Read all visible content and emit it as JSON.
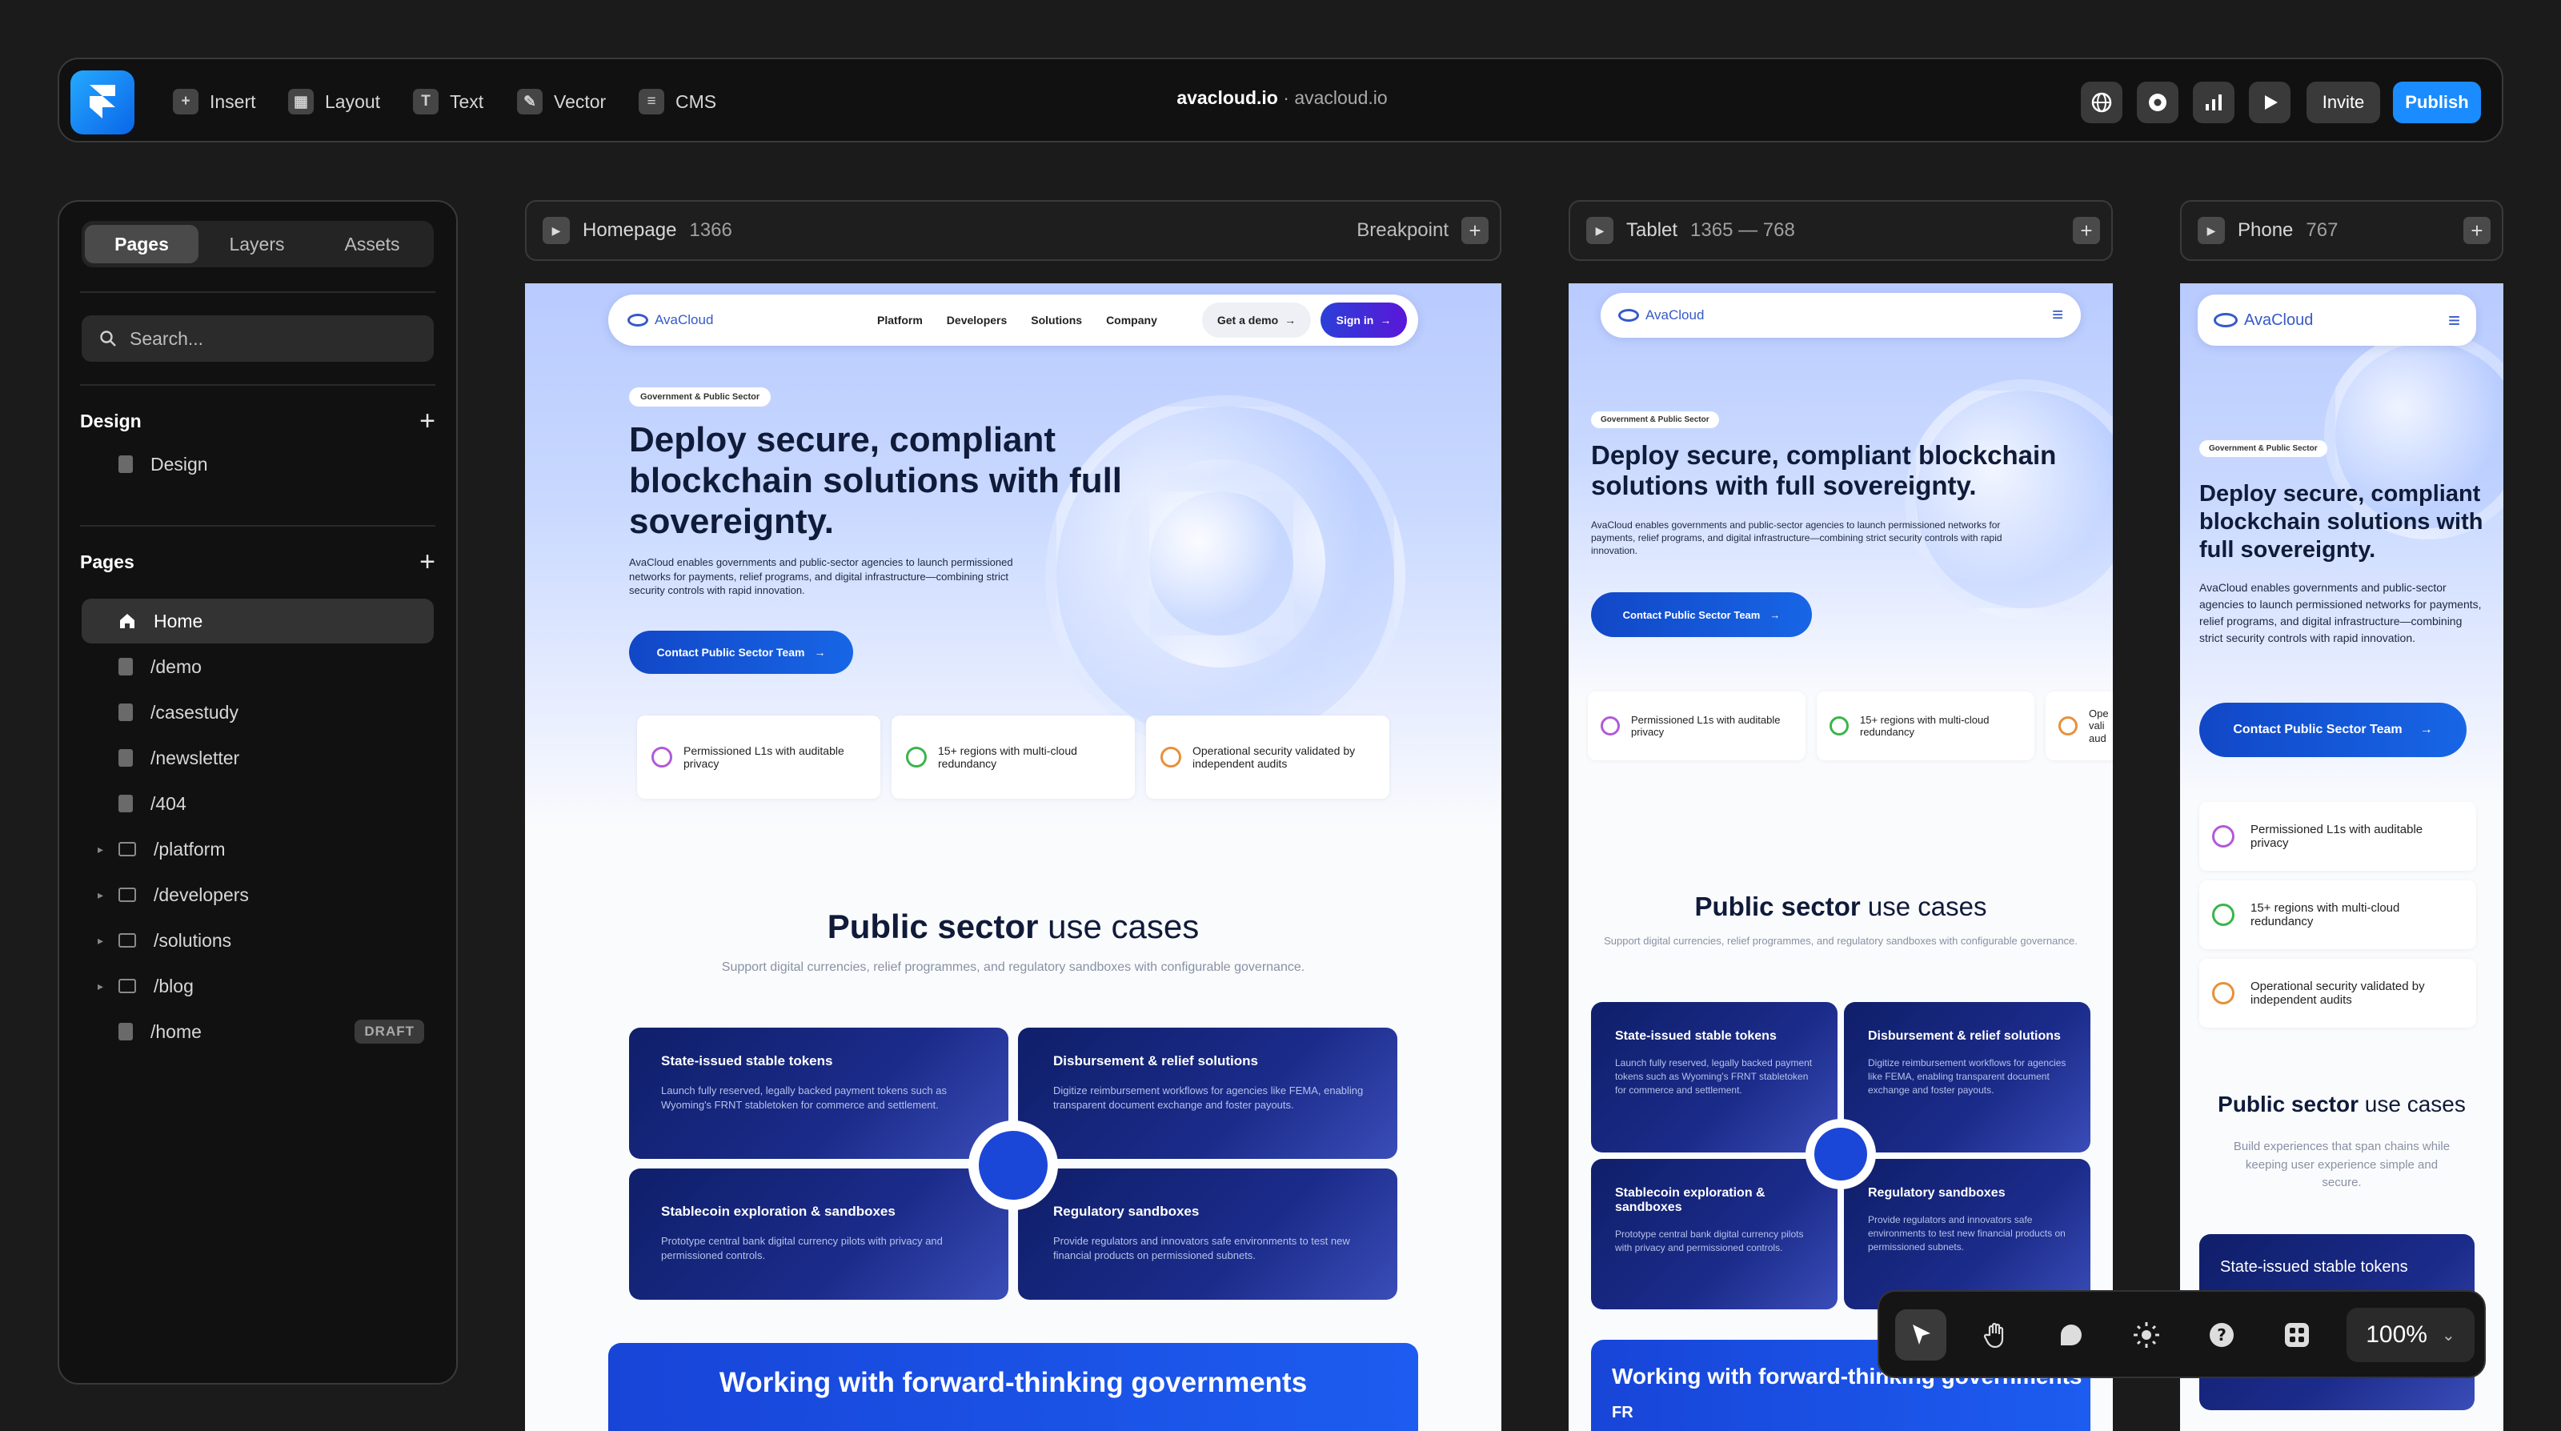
{
  "topbar": {
    "tools": [
      {
        "label": "Insert",
        "icon": "plus-square-icon"
      },
      {
        "label": "Layout",
        "icon": "layout-icon"
      },
      {
        "label": "Text",
        "icon": "text-icon"
      },
      {
        "label": "Vector",
        "icon": "pen-icon"
      },
      {
        "label": "CMS",
        "icon": "database-icon"
      }
    ],
    "site_name": "avacloud.io",
    "site_domain": "avacloud.io",
    "separator": "·",
    "invite_label": "Invite",
    "publish_label": "Publish",
    "publish_color": "#1a8cff"
  },
  "sidebar": {
    "tabs": [
      "Pages",
      "Layers",
      "Assets"
    ],
    "active_tab": "Pages",
    "search_placeholder": "Search...",
    "design_section": {
      "title": "Design",
      "items": [
        "Design"
      ]
    },
    "pages_section": {
      "title": "Pages",
      "items": [
        {
          "label": "Home"
        },
        {
          "label": "/demo"
        },
        {
          "label": "/casestudy"
        },
        {
          "label": "/newsletter"
        },
        {
          "label": "/404"
        },
        {
          "label": "/platform"
        },
        {
          "label": "/developers"
        },
        {
          "label": "/solutions"
        },
        {
          "label": "/blog"
        },
        {
          "label": "/home",
          "badge": "DRAFT"
        }
      ]
    }
  },
  "frames": {
    "homepage": {
      "name": "Homepage",
      "width": "1366",
      "breakpoint_label": "Breakpoint"
    },
    "tablet": {
      "name": "Tablet",
      "range": "1365 — 768"
    },
    "phone": {
      "name": "Phone",
      "width": "767"
    }
  },
  "site": {
    "brand": "AvaCloud",
    "nav": [
      "Platform",
      "Developers",
      "Solutions",
      "Company"
    ],
    "get_demo": "Get a demo",
    "sign_in": "Sign in",
    "badge": "Government & Public Sector",
    "title": "Deploy secure, compliant blockchain solutions with full sovereignty.",
    "description": "AvaCloud enables governments and public-sector agencies to launch permissioned networks for payments, relief programs, and digital infrastructure—combining strict security controls with rapid innovation.",
    "cta": "Contact Public Sector Team",
    "features": [
      "Permissioned L1s with auditable privacy",
      "15+ regions with multi-cloud redundancy",
      "Operational security validated by independent audits"
    ],
    "tablet_feature_3_truncated": "Ope vali aud",
    "section_title_bold": "Public sector",
    "section_title_rest": " use cases",
    "section_subtitle": "Support digital currencies, relief programmes, and regulatory sandboxes with configurable governance.",
    "phone_section_subtitle": "Build experiences that span chains while keeping user experience simple and secure.",
    "cards": [
      {
        "title": "State-issued stable tokens",
        "desc": "Launch fully reserved, legally backed payment tokens such as Wyoming's FRNT stabletoken for commerce and settlement."
      },
      {
        "title": "Disbursement & relief solutions",
        "desc": "Digitize reimbursement workflows for agencies like FEMA, enabling transparent document exchange and foster payouts."
      },
      {
        "title": "Stablecoin exploration & sandboxes",
        "desc": "Prototype central bank digital currency pilots with privacy and permissioned controls."
      },
      {
        "title": "Regulatory sandboxes",
        "desc": "Provide regulators and innovators safe environments to test new financial products on permissioned subnets."
      }
    ],
    "band_title": "Working with forward-thinking governments",
    "tablet_band_fragment": "FR"
  },
  "bottom_toolbar": {
    "tools": [
      "pointer-icon",
      "hand-icon",
      "comment-icon",
      "sun-icon",
      "help-icon",
      "plugin-icon"
    ],
    "zoom": "100%"
  }
}
